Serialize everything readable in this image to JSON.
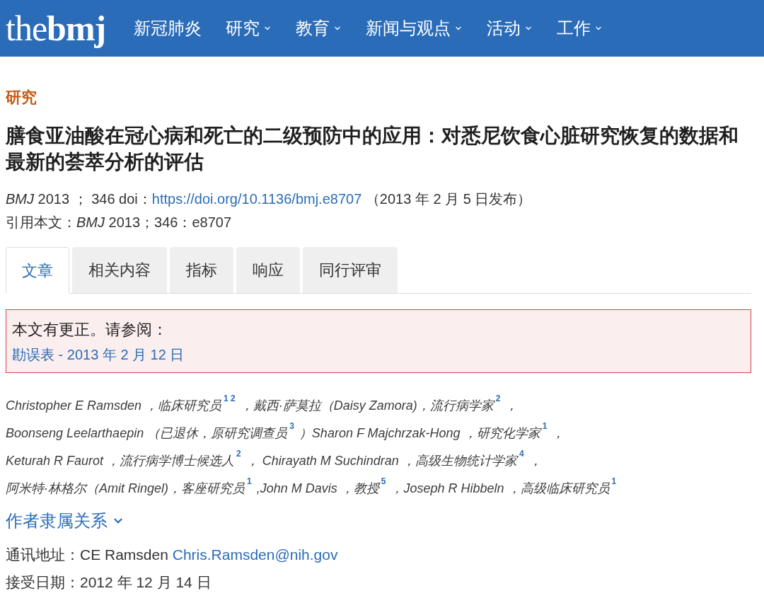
{
  "header": {
    "logo": "the**bmj**",
    "nav": [
      {
        "label": "新冠肺炎",
        "kind": "link"
      },
      {
        "label": "研究",
        "kind": "dropdown"
      },
      {
        "label": "教育",
        "kind": "dropdown"
      },
      {
        "label": "新闻与观点",
        "kind": "dropdown"
      },
      {
        "label": "活动",
        "kind": "dropdown"
      },
      {
        "label": "工作",
        "kind": "dropdown"
      }
    ]
  },
  "article_type": "研究",
  "title": "膳食亚油酸在冠心病和死亡的二级预防中的应用：对悉尼饮食心脏研究恢复的数据和最新的荟萃分析的评估",
  "citation": {
    "prefix": "*BMJ* 2013 ； 346 doi：",
    "doi_link": "https://doi.org/10.1136/bmj.e8707",
    "published": "（2013 年 2 月 5 日发布）"
  },
  "cite_as": "引用本文：*BMJ* 2013；346：e8707",
  "tabs": [
    {
      "label": "文章",
      "selected": true
    },
    {
      "label": "相关内容",
      "selected": false
    },
    {
      "label": "指标",
      "selected": false
    },
    {
      "label": "响应",
      "selected": false
    },
    {
      "label": "同行评审",
      "selected": false
    }
  ],
  "correction_notice": {
    "text": "本文有更正。请参阅：",
    "link": "勘误表 - 2013 年 2 月 12 日"
  },
  "author_lines": [
    "Christopher E Ramsden ，临床研究员$^{1 2}$ ，戴西·萨莫拉（Daisy Zamora)，流行病学家$^{2}$ ，",
    "Boonseng Leelarthaepin （已退休，原研究调查员$^{3}$ ）Sharon F Majchrzak-Hong ，研究化学家$^{1}$ ，",
    "Keturah R Faurot ，流行病学博士候选人$^{2}$ ， Chirayath M Suchindran ，高级生物统计学家$^{4}$ ，",
    "阿米特·林格尔（Amit Ringel)，客座研究员$^{1}$ ,John M Davis ，教授$^{5}$ ，Joseph R Hibbeln ，高级临床研究员$^{1}$"
  ],
  "affiliations": {
    "label": "作者隶属关系",
    "expanded": false
  },
  "correspondence": {
    "prefix": "通讯地址：CE Ramsden",
    "email": "Chris.Ramsden@nih.gov"
  },
  "accepted": "接受日期：2012 年 12 月 14 日"
}
